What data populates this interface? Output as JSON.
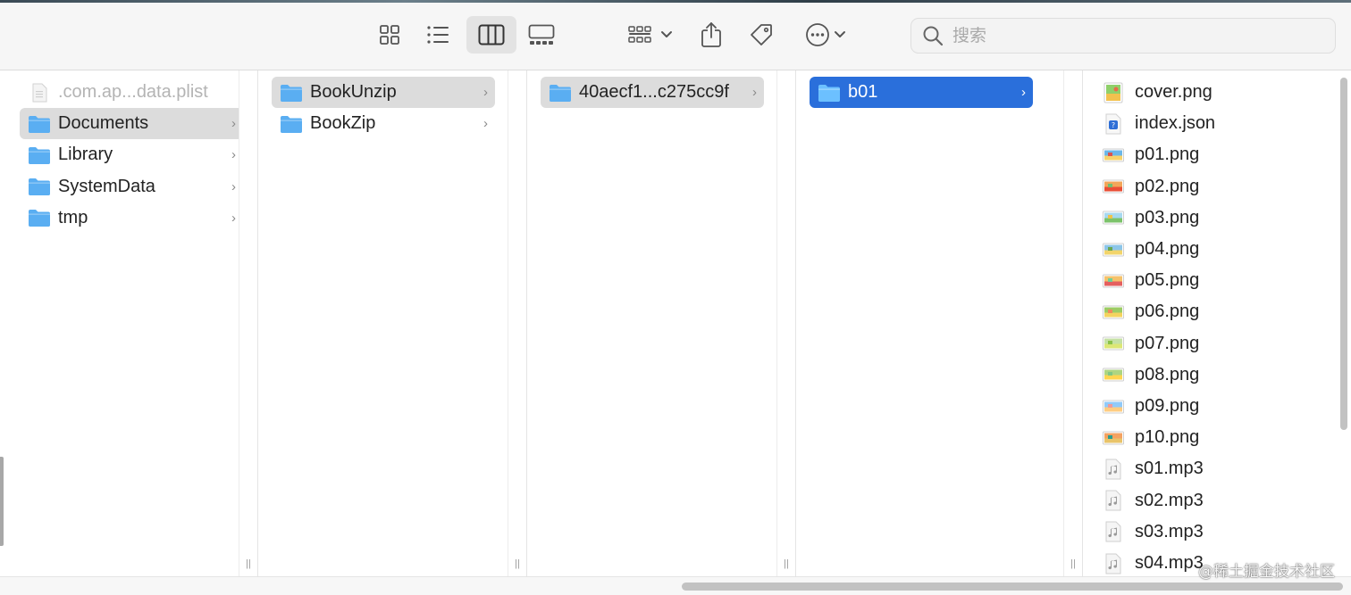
{
  "toolbar": {
    "view_icons": [
      "icon-view-icon",
      "list-view-icon",
      "column-view-icon",
      "gallery-view-icon"
    ],
    "group_icon": "group-by-icon",
    "share_icon": "share-icon",
    "tag_icon": "tag-icon",
    "more_icon": "more-actions-icon"
  },
  "search": {
    "placeholder": "搜索"
  },
  "columns": [
    {
      "items": [
        {
          "label": ".com.ap...data.plist",
          "type": "file",
          "dim": true,
          "chevron": false
        },
        {
          "label": "Documents",
          "type": "folder",
          "selected": "gray",
          "chevron": true
        },
        {
          "label": "Library",
          "type": "folder",
          "chevron": true
        },
        {
          "label": "SystemData",
          "type": "folder",
          "chevron": true
        },
        {
          "label": "tmp",
          "type": "folder",
          "chevron": true
        }
      ]
    },
    {
      "items": [
        {
          "label": "BookUnzip",
          "type": "folder",
          "selected": "gray",
          "chevron": true
        },
        {
          "label": "BookZip",
          "type": "folder",
          "chevron": true
        }
      ]
    },
    {
      "items": [
        {
          "label": "40aecf1...c275cc9f",
          "type": "folder",
          "selected": "gray",
          "chevron": true
        }
      ]
    },
    {
      "items": [
        {
          "label": "b01",
          "type": "folder",
          "selected": "blue",
          "chevron": true
        }
      ]
    }
  ],
  "files": [
    {
      "label": "cover.png",
      "kind": "image"
    },
    {
      "label": "index.json",
      "kind": "json"
    },
    {
      "label": "p01.png",
      "kind": "image"
    },
    {
      "label": "p02.png",
      "kind": "image"
    },
    {
      "label": "p03.png",
      "kind": "image"
    },
    {
      "label": "p04.png",
      "kind": "image"
    },
    {
      "label": "p05.png",
      "kind": "image"
    },
    {
      "label": "p06.png",
      "kind": "image"
    },
    {
      "label": "p07.png",
      "kind": "image"
    },
    {
      "label": "p08.png",
      "kind": "image"
    },
    {
      "label": "p09.png",
      "kind": "image"
    },
    {
      "label": "p10.png",
      "kind": "image"
    },
    {
      "label": "s01.mp3",
      "kind": "audio"
    },
    {
      "label": "s02.mp3",
      "kind": "audio"
    },
    {
      "label": "s03.mp3",
      "kind": "audio"
    },
    {
      "label": "s04.mp3",
      "kind": "audio"
    }
  ],
  "colors": {
    "folder": "#5aaef2",
    "selection_blue": "#2a6fdb",
    "selection_gray": "#dcdcdc"
  },
  "watermark": "@稀土掘金技术社区"
}
